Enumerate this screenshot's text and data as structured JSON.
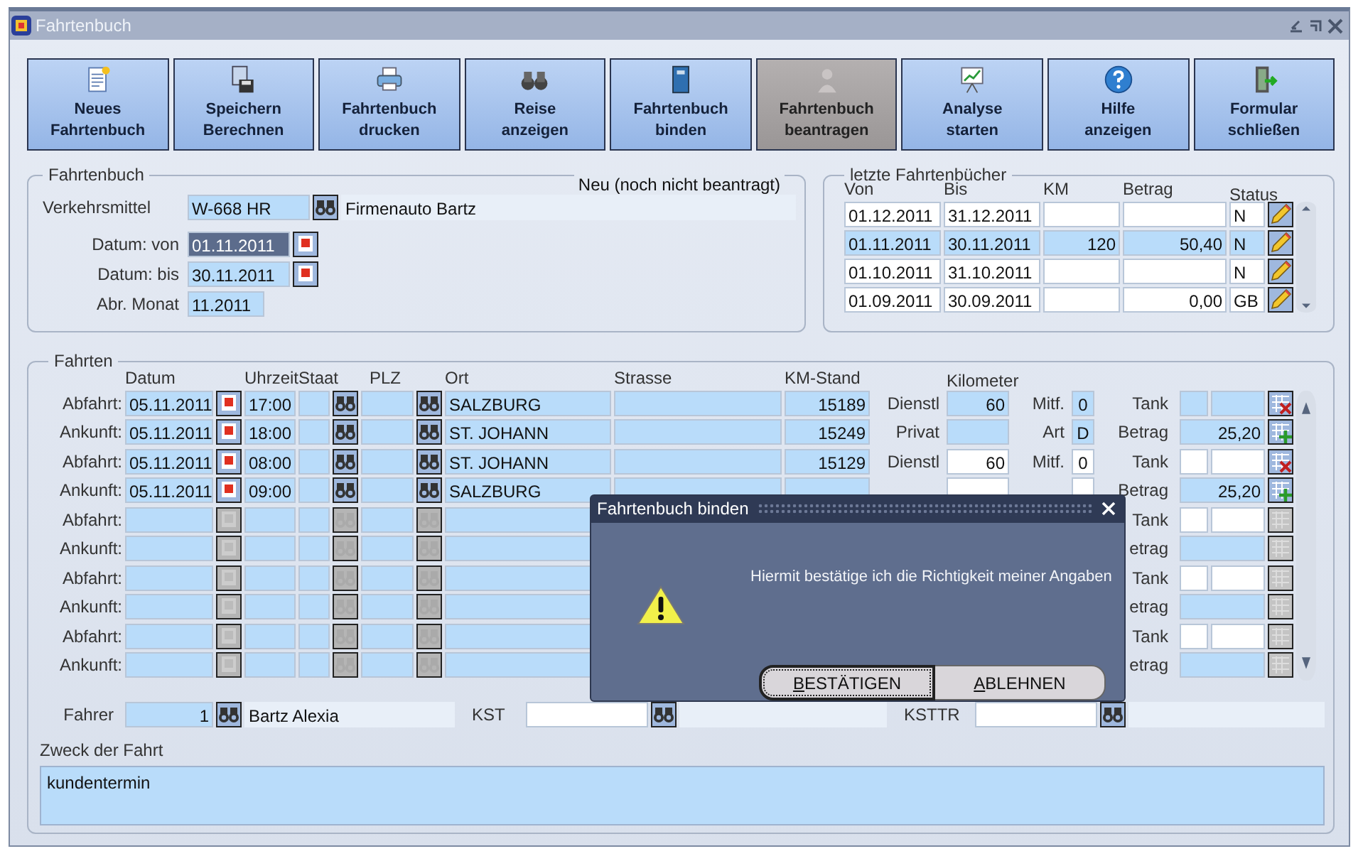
{
  "window": {
    "title": "Fahrtenbuch"
  },
  "toolbar": [
    {
      "label": "Neues\nFahrtenbuch",
      "disabled": false
    },
    {
      "label": "Speichern\nBerechnen",
      "disabled": false
    },
    {
      "label": "Fahrtenbuch\ndrucken",
      "disabled": false
    },
    {
      "label": "Reise\nanzeigen",
      "disabled": false
    },
    {
      "label": "Fahrtenbuch\nbinden",
      "disabled": false
    },
    {
      "label": "Fahrtenbuch\nbeantragen",
      "disabled": true
    },
    {
      "label": "Analyse\nstarten",
      "disabled": false
    },
    {
      "label": "Hilfe\nanzeigen",
      "disabled": false
    },
    {
      "label": "Formular\nschließen",
      "disabled": false
    }
  ],
  "logbook": {
    "title": "Fahrtenbuch",
    "status": "Neu (noch nicht beantragt)",
    "vehicle_label": "Verkehrsmittel",
    "vehicle": "W-668 HR",
    "vehicle_name": "Firmenauto Bartz",
    "dates": [
      {
        "label": "Datum: von",
        "value": "01.11.2011",
        "highlighted": true
      },
      {
        "label": "Datum: bis",
        "value": "30.11.2011",
        "highlighted": false
      }
    ],
    "month_label": "Abr. Monat",
    "month": "11.2011"
  },
  "recent": {
    "title": "letzte Fahrtenbücher",
    "columns": [
      "Von",
      "Bis",
      "KM",
      "Betrag",
      "Status"
    ],
    "rows": [
      {
        "from": "01.12.2011",
        "to": "31.12.2011",
        "status": "N",
        "selected": false
      },
      {
        "from": "01.11.2011",
        "to": "30.11.2011",
        "km": "120",
        "amount": "50,40",
        "status": "N",
        "selected": true
      },
      {
        "from": "01.10.2011",
        "to": "31.10.2011",
        "status": "N",
        "selected": false
      },
      {
        "from": "01.09.2011",
        "to": "30.09.2011",
        "amount": "0,00",
        "status": "GB",
        "selected": false
      }
    ]
  },
  "trips": {
    "title": "Fahrten",
    "columns": [
      "Datum",
      "Uhrzeit",
      "Staat",
      "PLZ",
      "Ort",
      "Strasse",
      "KM-Stand",
      "Kilometer"
    ],
    "items": [
      {
        "selected": true,
        "enabled": true,
        "legs": [
          {
            "kind": "departure",
            "label": "Abfahrt:",
            "date": "05.11.2011",
            "time": "17:00",
            "place": "SALZBURG",
            "odometer": "15189",
            "km_label": "Dienstl",
            "km": "60",
            "extra_label": "Mitf.",
            "extra": "0",
            "side_label": "Tank"
          },
          {
            "kind": "arrival",
            "label": "Ankunft:",
            "date": "05.11.2011",
            "time": "18:00",
            "place": "ST. JOHANN",
            "odometer": "15249",
            "km_label": "Privat",
            "extra_label": "Art",
            "extra": "D",
            "side_label": "Betrag",
            "side": "25,20"
          }
        ]
      },
      {
        "selected": false,
        "enabled": true,
        "legs": [
          {
            "kind": "departure",
            "label": "Abfahrt:",
            "date": "05.11.2011",
            "time": "08:00",
            "place": "ST. JOHANN",
            "odometer": "15129",
            "km_label": "Dienstl",
            "km": "60",
            "extra_label": "Mitf.",
            "extra": "0",
            "side_label": "Tank"
          },
          {
            "kind": "arrival",
            "label": "Ankunft:",
            "date": "05.11.2011",
            "time": "09:00",
            "place": "SALZBURG",
            "side_label": "Betrag",
            "side": "25,20"
          }
        ]
      },
      {
        "selected": false,
        "enabled": false,
        "legs": [
          {
            "kind": "departure",
            "label": "Abfahrt:",
            "side_label": "Tank"
          },
          {
            "kind": "arrival",
            "label": "Ankunft:",
            "side_label": "etrag"
          }
        ]
      },
      {
        "selected": false,
        "enabled": false,
        "legs": [
          {
            "kind": "departure",
            "label": "Abfahrt:",
            "side_label": "Tank"
          },
          {
            "kind": "arrival",
            "label": "Ankunft:",
            "side_label": "etrag"
          }
        ]
      },
      {
        "selected": false,
        "enabled": false,
        "legs": [
          {
            "kind": "departure",
            "label": "Abfahrt:",
            "side_label": "Tank"
          },
          {
            "kind": "arrival",
            "label": "Ankunft:",
            "side_label": "etrag"
          }
        ]
      }
    ]
  },
  "footer": {
    "driver_label": "Fahrer",
    "driver_no": "1",
    "driver_name": "Bartz Alexia",
    "kst_label": "KST",
    "ksttr_label": "KSTTR"
  },
  "purpose": {
    "label": "Zweck der Fahrt",
    "value": "kundentermin"
  },
  "dialog": {
    "title": "Fahrtenbuch binden",
    "message": "Hiermit bestätige ich die Richtigkeit meiner Angaben",
    "buttons": [
      {
        "label": "BESTÄTIGEN",
        "focused": true
      },
      {
        "label": "ABLEHNEN",
        "focused": false
      }
    ]
  }
}
